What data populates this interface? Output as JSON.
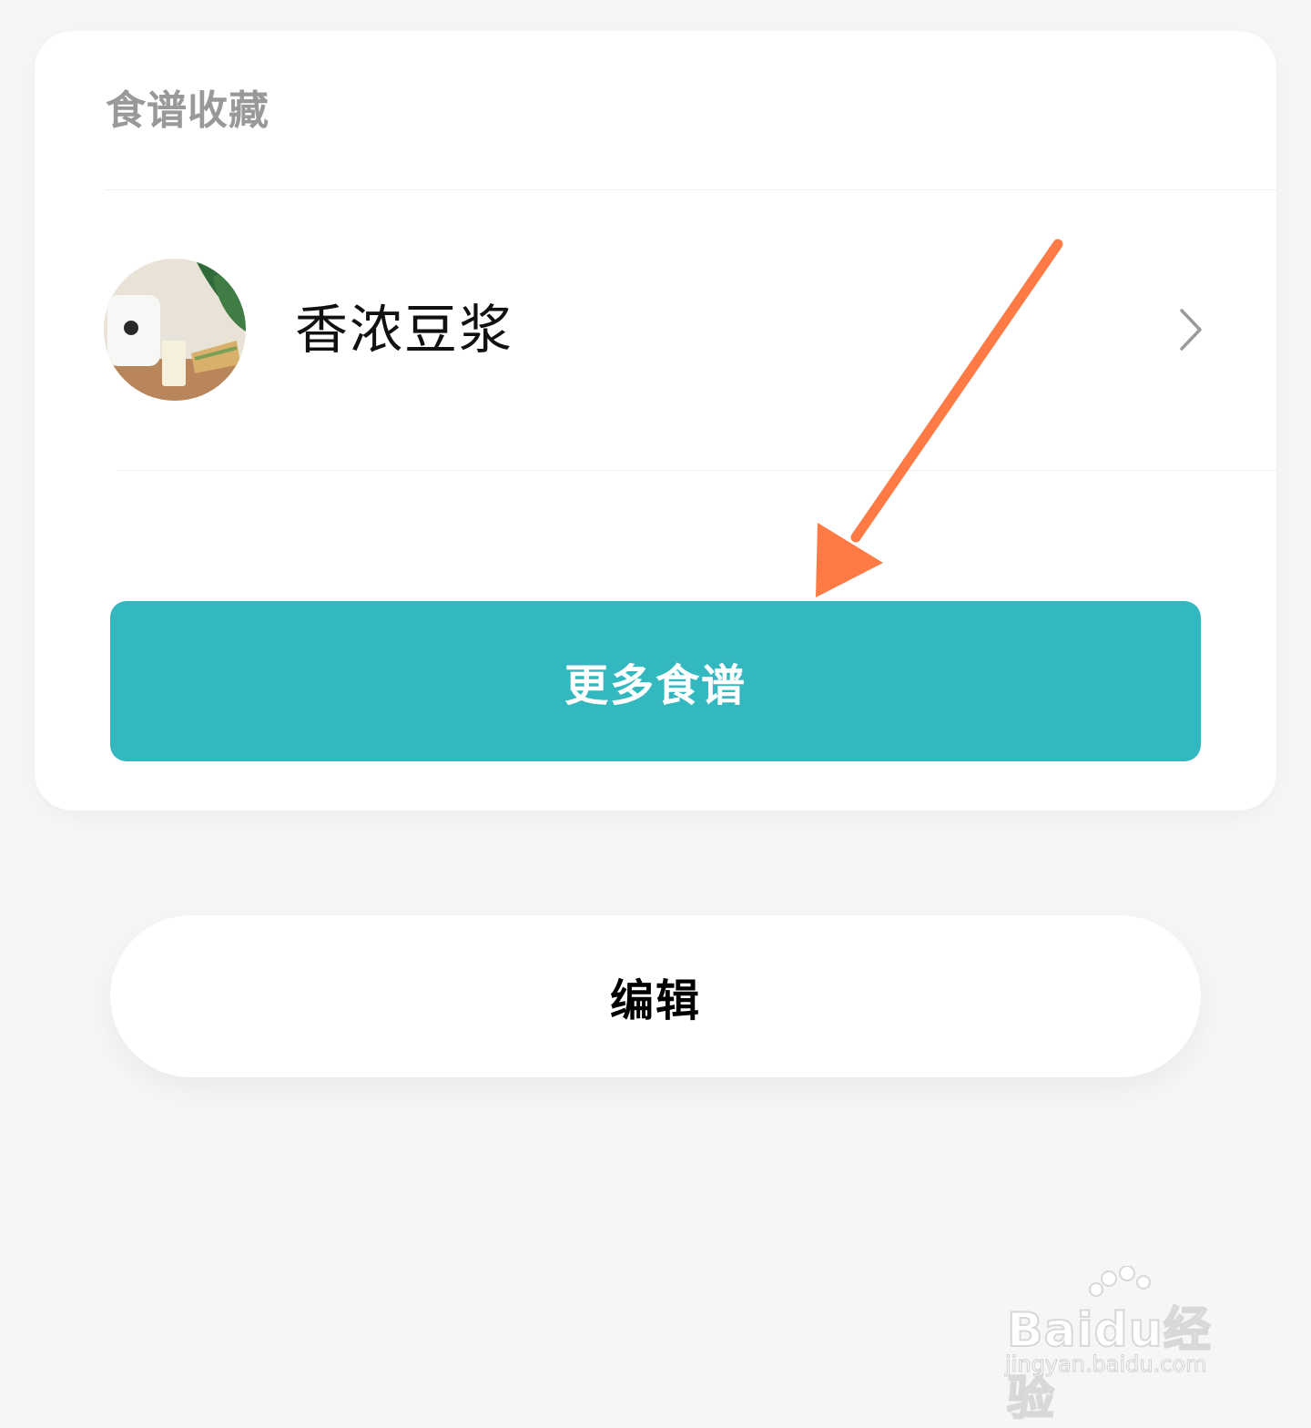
{
  "favorites": {
    "section_title": "食谱收藏",
    "items": [
      {
        "name": "香浓豆浆"
      }
    ],
    "more_button_label": "更多食谱"
  },
  "edit_button_label": "编辑",
  "icons": {
    "chevron": "chevron-right-icon",
    "annotation_arrow": "arrow-icon"
  },
  "colors": {
    "accent": "#34b8c0",
    "arrow": "#ff7a45",
    "background": "#f6f6f6",
    "card": "#ffffff",
    "section_title": "#999999"
  },
  "watermark": {
    "brand": "Baidu经验",
    "url": "jingyan.baidu.com"
  }
}
